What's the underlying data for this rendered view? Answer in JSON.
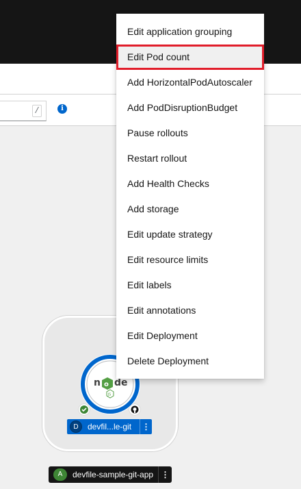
{
  "toolbar": {
    "search_shortcut": "/",
    "info_icon": "info-circle-icon"
  },
  "context_menu": {
    "items": [
      {
        "label": "Edit application grouping"
      },
      {
        "label": "Edit Pod count",
        "highlighted": true
      },
      {
        "label": "Add HorizontalPodAutoscaler"
      },
      {
        "label": "Add PodDisruptionBudget"
      },
      {
        "label": "Pause rollouts"
      },
      {
        "label": "Restart rollout"
      },
      {
        "label": "Add Health Checks"
      },
      {
        "label": "Add storage"
      },
      {
        "label": "Edit update strategy"
      },
      {
        "label": "Edit resource limits"
      },
      {
        "label": "Edit labels"
      },
      {
        "label": "Edit annotations"
      },
      {
        "label": "Edit Deployment"
      },
      {
        "label": "Delete Deployment"
      }
    ]
  },
  "topology": {
    "workload": {
      "type_badge": "D",
      "name": "devfil...le-git",
      "status_icon": "check-circle-icon",
      "source_icon": "github-icon",
      "logo": "nodejs-icon",
      "ring_color": "#0066cc"
    },
    "application": {
      "type_badge": "A",
      "name": "devfile-sample-git-app"
    }
  },
  "colors": {
    "masthead": "#151515",
    "highlight_outline": "#e11d2a",
    "accent": "#0066cc"
  }
}
